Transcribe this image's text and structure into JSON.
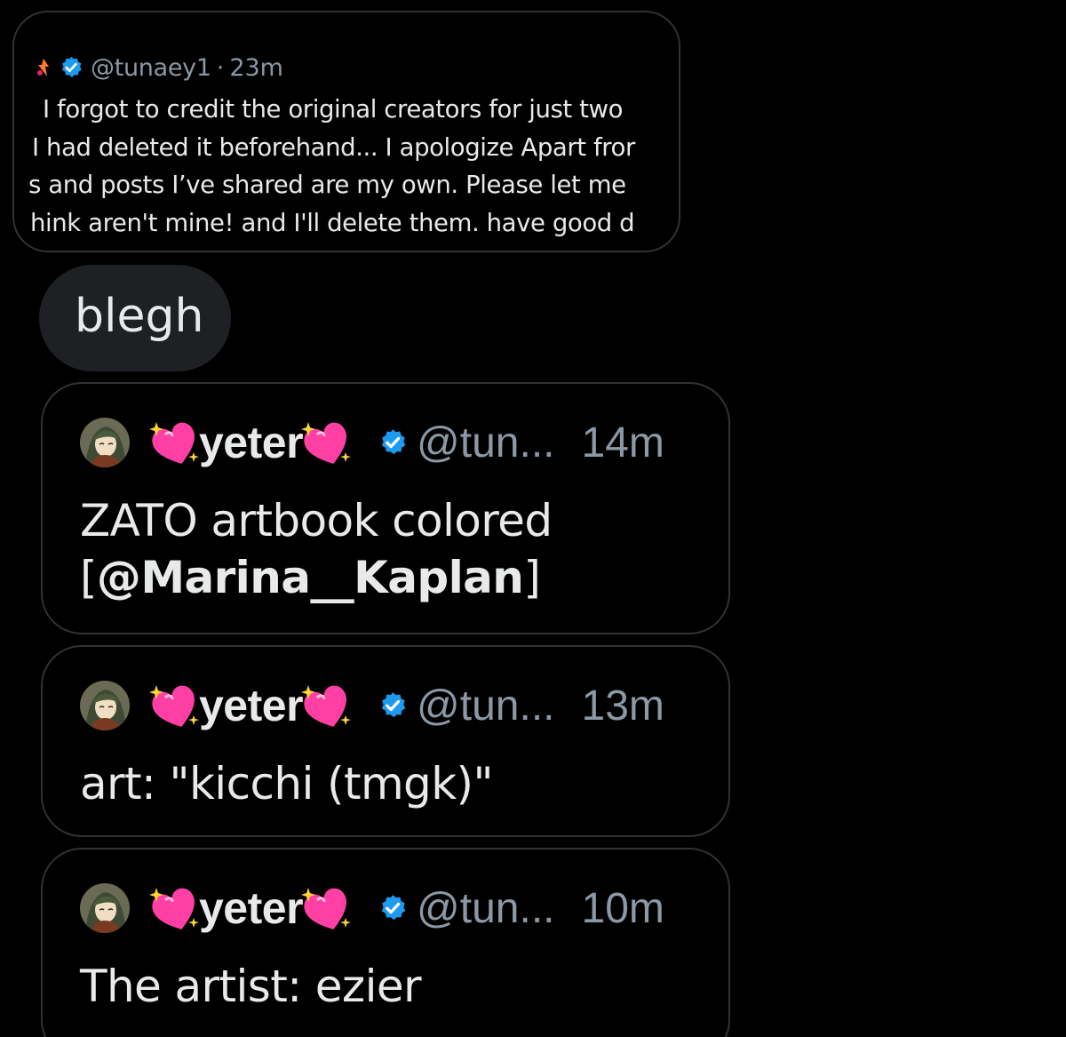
{
  "quote": {
    "handle": "@tunaey1",
    "separator": "·",
    "time": "23m",
    "lines": [
      "I forgot to credit the original creators for just two",
      "I had deleted it beforehand... I apologize Apart fror",
      "s and posts I’ve shared are my own. Please let me",
      "hink aren't mine! and I'll delete them. have good d"
    ]
  },
  "bubble": {
    "text": "blegh"
  },
  "tweets": [
    {
      "display_name": "yeter",
      "handle": "@tun...",
      "time": "14m",
      "text_line1": "ZATO artbook colored",
      "text_line2_open": "[",
      "text_line2_mention": "@Marina__Kaplan",
      "text_line2_close": "]"
    },
    {
      "display_name": "yeter",
      "handle": "@tun...",
      "time": "13m",
      "text_line1": "art: \"kicchi (tmgk)\""
    },
    {
      "display_name": "yeter",
      "handle": "@tun...",
      "time": "10m",
      "text_line1": "The artist: ezier"
    }
  ],
  "colors": {
    "background": "#000000",
    "text": "#e7e9ea",
    "muted": "#8b98a5",
    "border": "#2f3336",
    "bubble": "#1e2024",
    "verified": "#1d9bf0",
    "heart": "#ff3fa4"
  },
  "icons": {
    "verified": "verified-badge-icon",
    "heart": "sparkling-heart-icon",
    "avatar": "avatar"
  }
}
